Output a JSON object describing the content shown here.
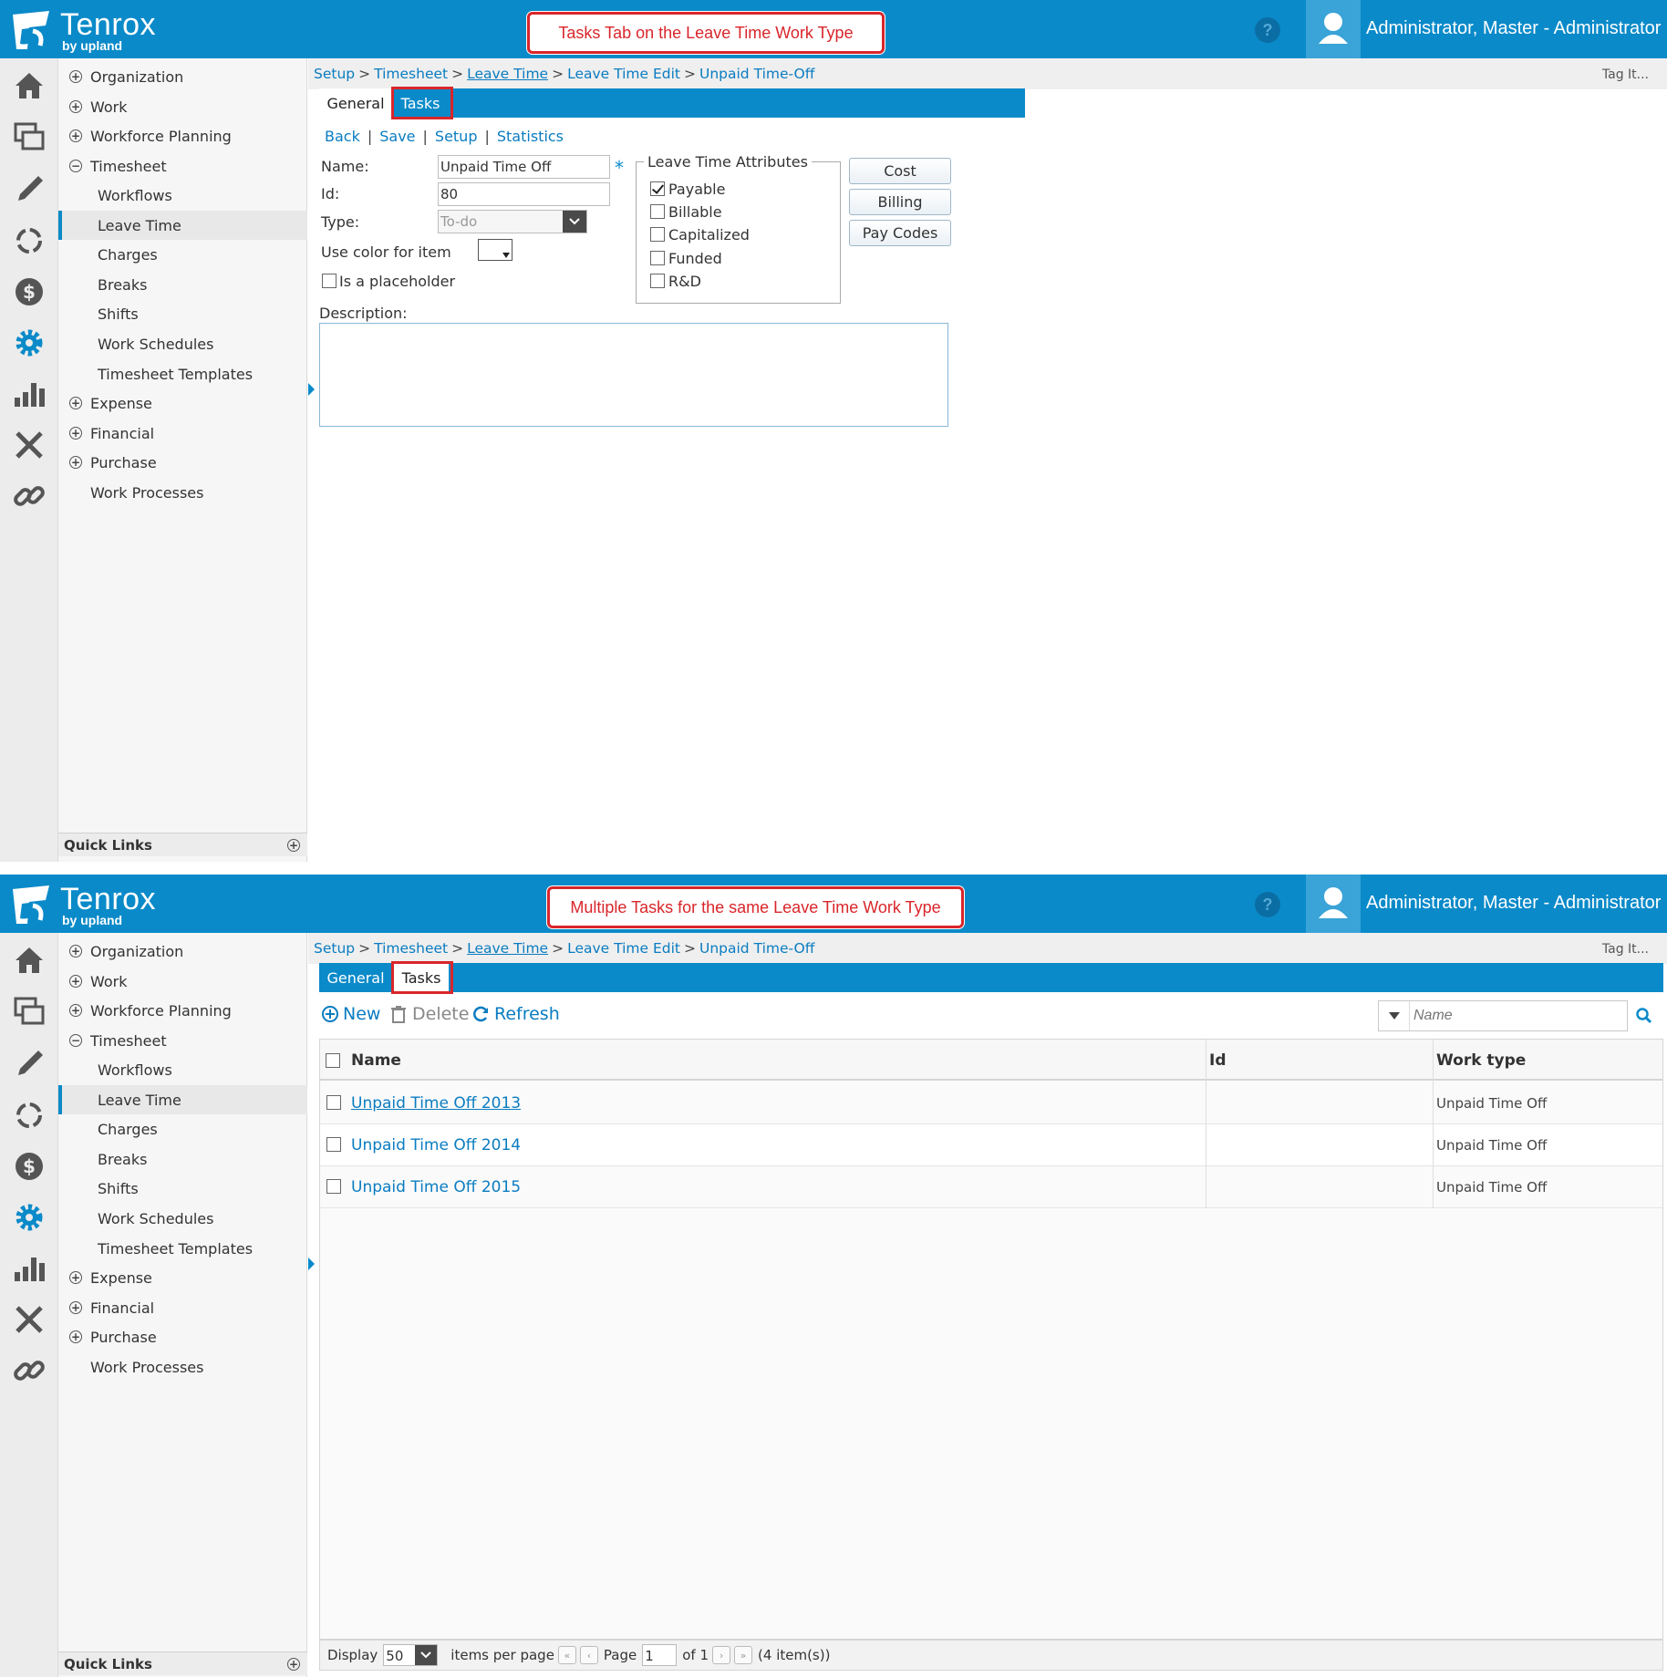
{
  "app": {
    "logo_name": "Tenrox",
    "logo_sub": "by upland",
    "help_glyph": "?",
    "username": "Administrator, Master - Administrator",
    "colors": {
      "header": "#0a8ac9",
      "link": "#0a7cc1",
      "callout_red": "#d9262b"
    }
  },
  "rail_icons": [
    "home-icon",
    "windows-icon",
    "pencil-icon",
    "refresh-cycle-icon",
    "dollar-icon",
    "gear-icon",
    "bar-chart-icon",
    "tools-icon",
    "link-icon"
  ],
  "nav": {
    "organization": "Organization",
    "work": "Work",
    "workforce_planning": "Workforce Planning",
    "timesheet": "Timesheet",
    "workflows": "Workflows",
    "leave_time": "Leave Time",
    "charges": "Charges",
    "breaks": "Breaks",
    "shifts": "Shifts",
    "work_schedules": "Work Schedules",
    "timesheet_templates": "Timesheet Templates",
    "expense": "Expense",
    "financial": "Financial",
    "purchase": "Purchase",
    "work_processes": "Work Processes",
    "quick_links": "Quick Links",
    "expand_glyph": "+",
    "collapse_glyph": "−"
  },
  "breadcrumb": {
    "setup": "Setup",
    "timesheet": "Timesheet",
    "leave_time": "Leave Time",
    "leave_time_edit": "Leave Time Edit",
    "current": "Unpaid Time-Off",
    "sep": ">"
  },
  "tag_it": "Tag It...",
  "tabs": {
    "general": "General",
    "tasks": "Tasks"
  },
  "screen1": {
    "callout": "Tasks Tab on the Leave Time Work Type",
    "links": {
      "back": "Back",
      "save": "Save",
      "setup": "Setup",
      "statistics": "Statistics",
      "sep": "|"
    },
    "form": {
      "name_label": "Name:",
      "name_value": "Unpaid Time Off",
      "required_mark": "*",
      "id_label": "Id:",
      "id_value": "80",
      "type_label": "Type:",
      "type_value": "To-do",
      "color_label": "Use color for item",
      "placeholder_label": "Is a placeholder",
      "placeholder_checked": false,
      "description_label": "Description:",
      "description_value": ""
    },
    "attributes": {
      "legend": "Leave Time Attributes",
      "items": [
        {
          "label": "Payable",
          "checked": true
        },
        {
          "label": "Billable",
          "checked": false
        },
        {
          "label": "Capitalized",
          "checked": false
        },
        {
          "label": "Funded",
          "checked": false
        },
        {
          "label": "R&D",
          "checked": false
        }
      ]
    },
    "buttons": {
      "cost": "Cost",
      "billing": "Billing",
      "pay_codes": "Pay Codes"
    }
  },
  "screen2": {
    "callout": "Multiple Tasks for the same Leave Time Work Type",
    "toolbar": {
      "new": "New",
      "delete": "Delete",
      "refresh": "Refresh",
      "search_placeholder": "Name"
    },
    "grid": {
      "columns": {
        "name": "Name",
        "id": "Id",
        "work_type": "Work type"
      },
      "rows": [
        {
          "name": "Unpaid Time Off 2013",
          "id": "",
          "work_type": "Unpaid Time Off"
        },
        {
          "name": "Unpaid Time Off 2014",
          "id": "",
          "work_type": "Unpaid Time Off"
        },
        {
          "name": "Unpaid Time Off 2015",
          "id": "",
          "work_type": "Unpaid Time Off"
        }
      ]
    },
    "pager": {
      "display": "Display",
      "page_size": "50",
      "items_per_page": "items per page",
      "page": "Page",
      "page_value": "1",
      "of": "of 1",
      "count": "(4 item(s))",
      "first_glyph": "«",
      "prev_glyph": "‹",
      "next_glyph": "›",
      "last_glyph": "»"
    }
  }
}
